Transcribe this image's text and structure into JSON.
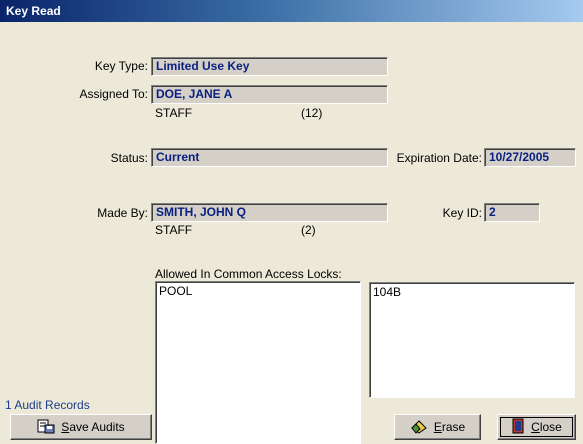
{
  "window": {
    "title": "Key Read"
  },
  "fields": {
    "key_type": {
      "label": "Key Type:",
      "value": "Limited Use Key"
    },
    "assigned_to": {
      "label": "Assigned To:",
      "value": "DOE, JANE A",
      "role": "STAFF",
      "number": "(12)"
    },
    "status": {
      "label": "Status:",
      "value": "Current"
    },
    "expiration": {
      "label": "Expiration Date:",
      "value": "10/27/2005"
    },
    "made_by": {
      "label": "Made By:",
      "value": "SMITH, JOHN Q",
      "role": "STAFF",
      "number": "(2)"
    },
    "key_id": {
      "label": "Key ID:",
      "value": "2"
    }
  },
  "locks": {
    "label": "Allowed In Common Access Locks:",
    "common_items": [
      "POOL"
    ],
    "other_items": [
      "104B"
    ]
  },
  "audit": {
    "count_text": "1 Audit Records"
  },
  "buttons": {
    "save_audits": {
      "prefix": "",
      "mnemonic": "S",
      "rest": "ave Audits"
    },
    "erase": {
      "mnemonic": "E",
      "rest": "rase"
    },
    "close": {
      "mnemonic": "C",
      "rest": "lose"
    }
  },
  "colors": {
    "value_text": "#0A2080",
    "title_start": "#0A246A",
    "title_end": "#A6CAF0"
  }
}
